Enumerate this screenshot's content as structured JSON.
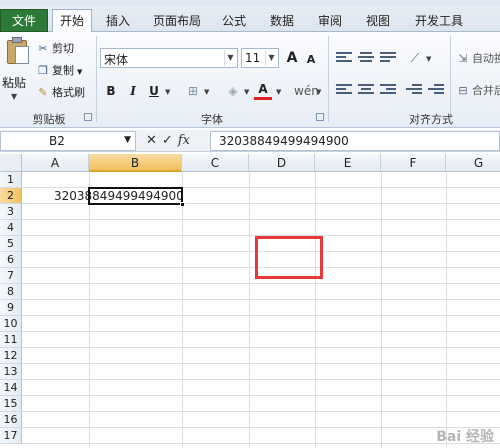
{
  "ribbon_tabs": [
    "文件",
    "开始",
    "插入",
    "页面布局",
    "公式",
    "数据",
    "审阅",
    "视图",
    "开发工具"
  ],
  "clipboard": {
    "paste": "粘贴",
    "cut": "剪切",
    "copy": "复制",
    "format_painter": "格式刷",
    "group_label": "剪贴板"
  },
  "font": {
    "font_name": "宋体",
    "font_size": "11",
    "grow": "A",
    "shrink": "A",
    "bold": "B",
    "italic": "I",
    "underline": "U",
    "color_a": "A",
    "phonetic": "wén",
    "group_label": "字体"
  },
  "alignment": {
    "wrap_text": "自动换",
    "merge": "合并后",
    "group_label": "对齐方式"
  },
  "formula_bar": {
    "name_box": "B2",
    "cancel": "✕",
    "enter": "✓",
    "fx": "fx",
    "content": "32038849499494900"
  },
  "sheet": {
    "columns": [
      "A",
      "B",
      "C",
      "D",
      "E",
      "F",
      "G"
    ],
    "selected_column": "B",
    "rows": [
      "1",
      "2",
      "3",
      "4",
      "5",
      "6",
      "7",
      "8",
      "9",
      "10",
      "11",
      "12",
      "13",
      "14",
      "15",
      "16",
      "17"
    ],
    "selected_row": "2",
    "cell_A2": "32038849499494900"
  },
  "colors": {
    "file_tab": "#2d7a38",
    "highlight_box": "#e8393a",
    "selected_header": "#f1c15f"
  },
  "watermark": "Bai 经验"
}
